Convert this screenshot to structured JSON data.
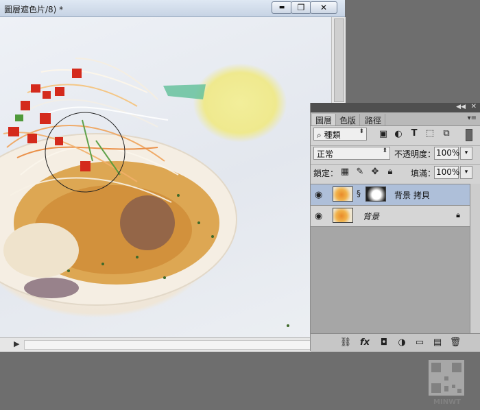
{
  "document": {
    "title": "圖層遮色片/8) *",
    "buttons": {
      "minimize": "▬",
      "maximize": "❐",
      "close": "✕"
    }
  },
  "layers_panel": {
    "tabs": [
      {
        "label": "圖層",
        "active": true
      },
      {
        "label": "色版",
        "active": false
      },
      {
        "label": "路徑",
        "active": false
      }
    ],
    "filter_kind": "種類",
    "blend_mode": "正常",
    "opacity_label": "不透明度：",
    "opacity_value": "100%",
    "lock_label": "鎖定：",
    "fill_label": "填滿：",
    "fill_value": "100%",
    "layers": [
      {
        "name": "背景 拷貝",
        "visible": true,
        "has_mask": true,
        "selected": true,
        "locked": false
      },
      {
        "name": "背景",
        "visible": true,
        "has_mask": false,
        "selected": false,
        "locked": true
      }
    ]
  },
  "watermark": {
    "text": "MINWT"
  },
  "colors": {
    "selection": "#aebfd9",
    "panel": "#d3d3d3",
    "titlebar": "#c6d3e4"
  },
  "icons": [
    "search-icon",
    "image-filter-icon",
    "adjustment-filter-icon",
    "text-filter-icon",
    "shape-filter-icon",
    "smart-object-filter-icon",
    "eye-icon",
    "chain-icon",
    "lock-icon",
    "link-layers-icon",
    "fx-icon",
    "add-mask-icon",
    "adjustment-layer-icon",
    "group-folder-icon",
    "new-layer-icon",
    "trash-icon"
  ]
}
